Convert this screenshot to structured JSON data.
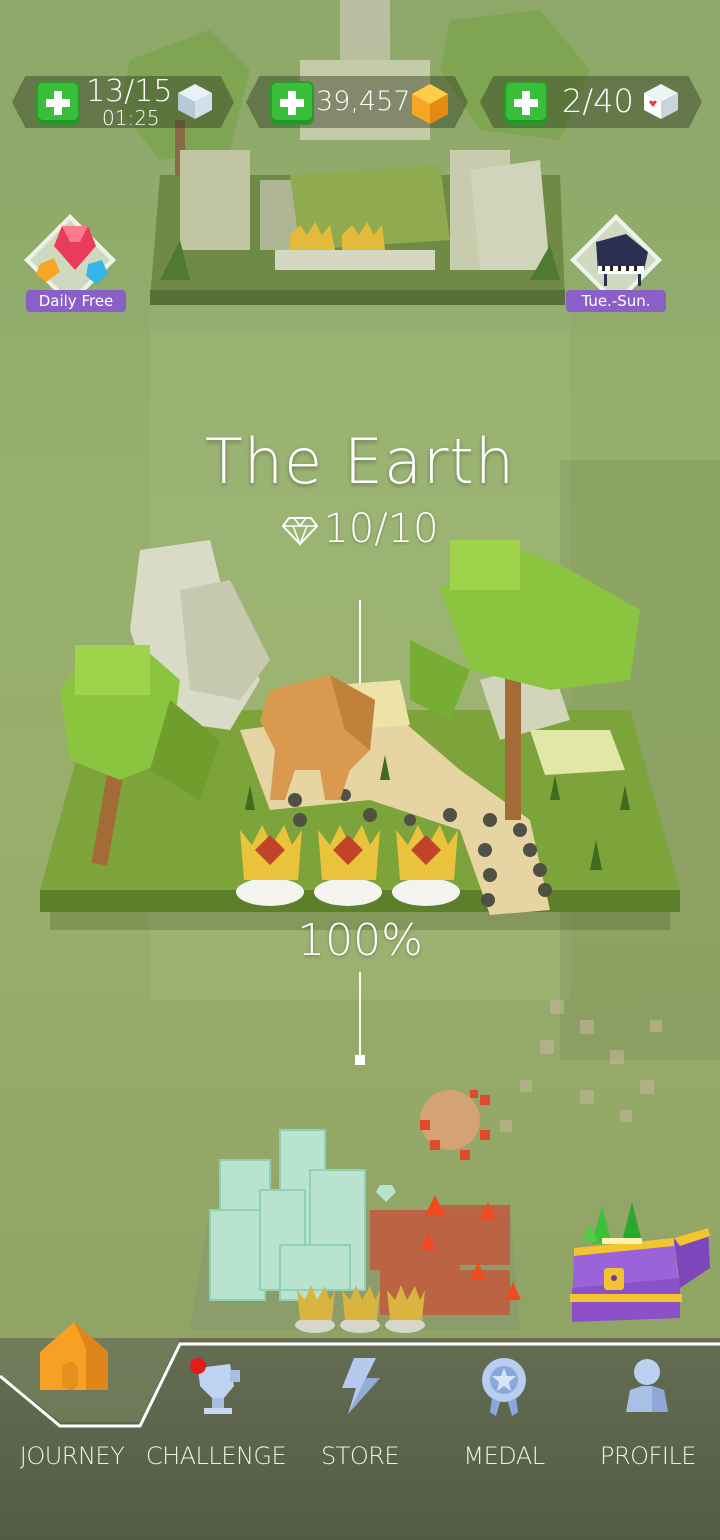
{
  "resources": {
    "energy": {
      "value": "13/15",
      "timer": "01:25"
    },
    "coins": {
      "value": "39,457"
    },
    "hearts": {
      "value": "2/40"
    }
  },
  "side_badges": {
    "left_label": "Daily Free",
    "right_label": "Tue.-Sun."
  },
  "level": {
    "title": "The Earth",
    "gems": "10/10",
    "progress": "100%"
  },
  "bottom_nav": [
    {
      "label": "JOURNEY",
      "icon": "house-icon"
    },
    {
      "label": "CHALLENGE",
      "icon": "trophy-icon"
    },
    {
      "label": "STORE",
      "icon": "lightning-icon"
    },
    {
      "label": "MEDAL",
      "icon": "medal-icon"
    },
    {
      "label": "PROFILE",
      "icon": "profile-icon"
    }
  ],
  "colors": {
    "plus_green": "#3bbf3a",
    "badge_purple": "#8a5fc7",
    "coin_orange": "#f5a623",
    "nav_bg": "#5c6449",
    "notification_red": "#e21b1b"
  }
}
